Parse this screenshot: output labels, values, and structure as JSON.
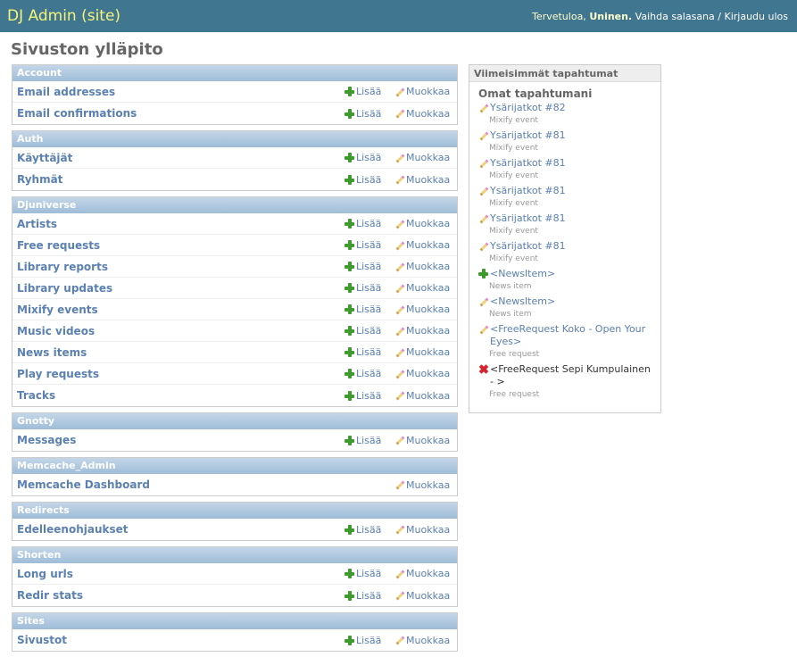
{
  "header": {
    "branding": "DJ Admin (site)",
    "welcome": "Tervetuloa,",
    "username": "Uninen.",
    "change_password": "Vaihda salasana",
    "separator": "/",
    "logout": "Kirjaudu ulos"
  },
  "page_title": "Sivuston ylläpito",
  "link_labels": {
    "add": "Lisää",
    "change": "Muokkaa"
  },
  "apps": [
    {
      "name": "Account",
      "models": [
        {
          "name": "Email addresses",
          "add": true
        },
        {
          "name": "Email confirmations",
          "add": true
        }
      ]
    },
    {
      "name": "Auth",
      "models": [
        {
          "name": "Käyttäjät",
          "add": true
        },
        {
          "name": "Ryhmät",
          "add": true
        }
      ]
    },
    {
      "name": "Djuniverse",
      "models": [
        {
          "name": "Artists",
          "add": true
        },
        {
          "name": "Free requests",
          "add": true
        },
        {
          "name": "Library reports",
          "add": true
        },
        {
          "name": "Library updates",
          "add": true
        },
        {
          "name": "Mixify events",
          "add": true
        },
        {
          "name": "Music videos",
          "add": true
        },
        {
          "name": "News items",
          "add": true
        },
        {
          "name": "Play requests",
          "add": true
        },
        {
          "name": "Tracks",
          "add": true
        }
      ]
    },
    {
      "name": "Gnotty",
      "models": [
        {
          "name": "Messages",
          "add": true
        }
      ]
    },
    {
      "name": "Memcache_Admin",
      "models": [
        {
          "name": "Memcache Dashboard",
          "add": false
        }
      ]
    },
    {
      "name": "Redirects",
      "models": [
        {
          "name": "Edelleenohjaukset",
          "add": true
        }
      ]
    },
    {
      "name": "Shorten",
      "models": [
        {
          "name": "Long urls",
          "add": true
        },
        {
          "name": "Redir stats",
          "add": true
        }
      ]
    },
    {
      "name": "Sites",
      "models": [
        {
          "name": "Sivustot",
          "add": true
        }
      ]
    }
  ],
  "recent_actions": {
    "caption": "Viimeisimmät tapahtumat",
    "subtitle": "Omat tapahtumani",
    "items": [
      {
        "icon": "pencil-icon",
        "type": "change",
        "title": "Ysärijatkot #82",
        "meta": "Mixify event"
      },
      {
        "icon": "pencil-icon",
        "type": "change",
        "title": "Ysärijatkot #81",
        "meta": "Mixify event"
      },
      {
        "icon": "pencil-icon",
        "type": "change",
        "title": "Ysärijatkot #81",
        "meta": "Mixify event"
      },
      {
        "icon": "pencil-icon",
        "type": "change",
        "title": "Ysärijatkot #81",
        "meta": "Mixify event"
      },
      {
        "icon": "pencil-icon",
        "type": "change",
        "title": "Ysärijatkot #81",
        "meta": "Mixify event"
      },
      {
        "icon": "pencil-icon",
        "type": "change",
        "title": "Ysärijatkot #81",
        "meta": "Mixify event"
      },
      {
        "icon": "plus-icon",
        "type": "add",
        "title": "<NewsItem>",
        "meta": "News item"
      },
      {
        "icon": "pencil-icon",
        "type": "change",
        "title": "<NewsItem>",
        "meta": "News item"
      },
      {
        "icon": "pencil-icon",
        "type": "change",
        "title": "<FreeRequest Koko - Open Your Eyes>",
        "meta": "Free request"
      },
      {
        "icon": "delete-icon",
        "type": "delete",
        "title": "<FreeRequest Sepi Kumpulainen - >",
        "meta": "Free request"
      }
    ]
  }
}
